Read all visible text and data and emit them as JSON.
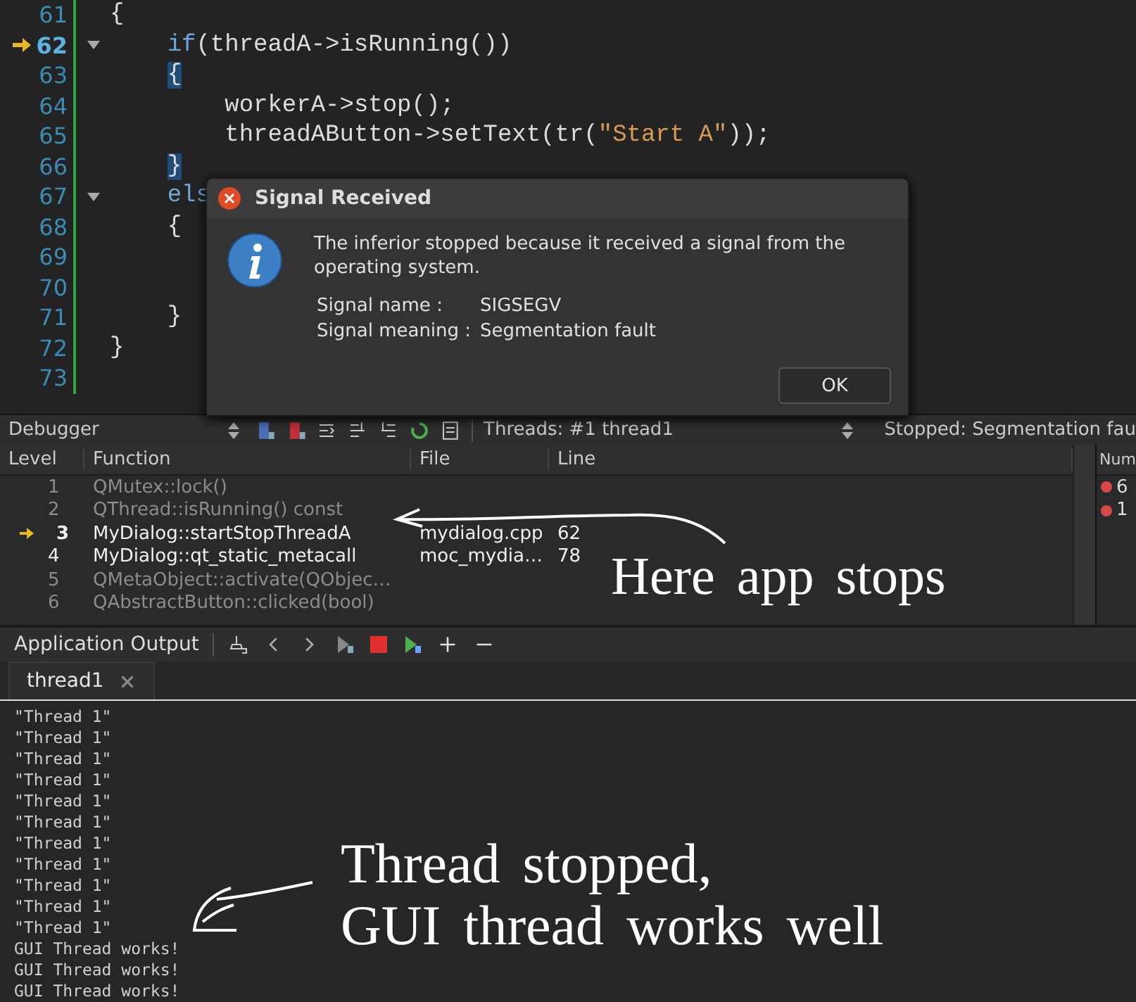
{
  "editor": {
    "lines": [
      {
        "number": "61",
        "current": false,
        "fold": false,
        "tokens": [
          {
            "kind": "plain",
            "text": "{"
          }
        ]
      },
      {
        "number": "62",
        "current": true,
        "fold": true,
        "tokens": [
          {
            "kind": "keyword",
            "text": "    if"
          },
          {
            "kind": "plain",
            "text": "(threadA->isRunning())"
          }
        ]
      },
      {
        "number": "63",
        "current": false,
        "fold": false,
        "tokens": [
          {
            "kind": "bracket",
            "text": "    {"
          }
        ]
      },
      {
        "number": "64",
        "current": false,
        "fold": false,
        "tokens": [
          {
            "kind": "plain",
            "text": "        workerA->stop();"
          }
        ]
      },
      {
        "number": "65",
        "current": false,
        "fold": false,
        "tokens": [
          {
            "kind": "plain",
            "text": "        threadAButton->setText(tr("
          },
          {
            "kind": "string",
            "text": "\"Start A\""
          },
          {
            "kind": "plain",
            "text": "));"
          }
        ]
      },
      {
        "number": "66",
        "current": false,
        "fold": false,
        "tokens": [
          {
            "kind": "bracket",
            "text": "    }"
          }
        ]
      },
      {
        "number": "67",
        "current": false,
        "fold": true,
        "tokens": [
          {
            "kind": "keyword",
            "text": "    els"
          }
        ]
      },
      {
        "number": "68",
        "current": false,
        "fold": false,
        "tokens": [
          {
            "kind": "plain",
            "text": "    {"
          }
        ]
      },
      {
        "number": "69",
        "current": false,
        "fold": false
      },
      {
        "number": "70",
        "current": false,
        "fold": false
      },
      {
        "number": "71",
        "current": false,
        "fold": false,
        "tokens": [
          {
            "kind": "plain",
            "text": "    }"
          }
        ]
      },
      {
        "number": "72",
        "current": false,
        "fold": false,
        "tokens": [
          {
            "kind": "plain",
            "text": "}"
          }
        ]
      },
      {
        "number": "73",
        "current": false,
        "fold": false
      }
    ]
  },
  "dialog": {
    "title": "Signal Received",
    "message": "The inferior stopped because it received a signal from the operating system.",
    "fields": [
      {
        "label": "Signal name :",
        "value": "SIGSEGV"
      },
      {
        "label": "Signal meaning :",
        "value": "Segmentation fault"
      }
    ],
    "buttons": [
      "OK"
    ]
  },
  "debugger": {
    "title": "Debugger",
    "threads_label": "Threads:",
    "thread": "#1 thread1",
    "status": "Stopped: Segmentation fau",
    "columns": [
      "Level",
      "Function",
      "File",
      "Line"
    ],
    "frames": [
      {
        "level": "1",
        "function": "QMutex::lock()",
        "has_source": false,
        "current": false
      },
      {
        "level": "2",
        "function": "QThread::isRunning() const",
        "has_source": false,
        "current": false
      },
      {
        "level": "3",
        "function": "MyDialog::startStopThreadA",
        "file": "mydialog.cpp",
        "line": "62",
        "has_source": true,
        "current": true
      },
      {
        "level": "4",
        "function": "MyDialog::qt_static_metacall",
        "file": "moc_mydia…",
        "line": "78",
        "has_source": true,
        "current": false
      },
      {
        "level": "5",
        "function": "QMetaObject::activate(QObjec…",
        "has_source": false,
        "current": false
      },
      {
        "level": "6",
        "function": "QAbstractButton::clicked(bool)",
        "has_source": false,
        "current": false
      }
    ],
    "breakpoints": {
      "column": "Num",
      "rows": [
        "6",
        "1"
      ]
    },
    "note": "Here app stops"
  },
  "output": {
    "title": "Application Output",
    "tabs": [
      {
        "label": "thread1",
        "selected": true
      }
    ],
    "lines": [
      "\"Thread 1\"",
      "\"Thread 1\"",
      "\"Thread 1\"",
      "\"Thread 1\"",
      "\"Thread 1\"",
      "\"Thread 1\"",
      "\"Thread 1\"",
      "\"Thread 1\"",
      "\"Thread 1\"",
      "\"Thread 1\"",
      "\"Thread 1\"",
      "GUI Thread works!",
      "GUI Thread works!",
      "GUI Thread works!"
    ],
    "note": "Thread stopped,\nGUI thread works well"
  }
}
